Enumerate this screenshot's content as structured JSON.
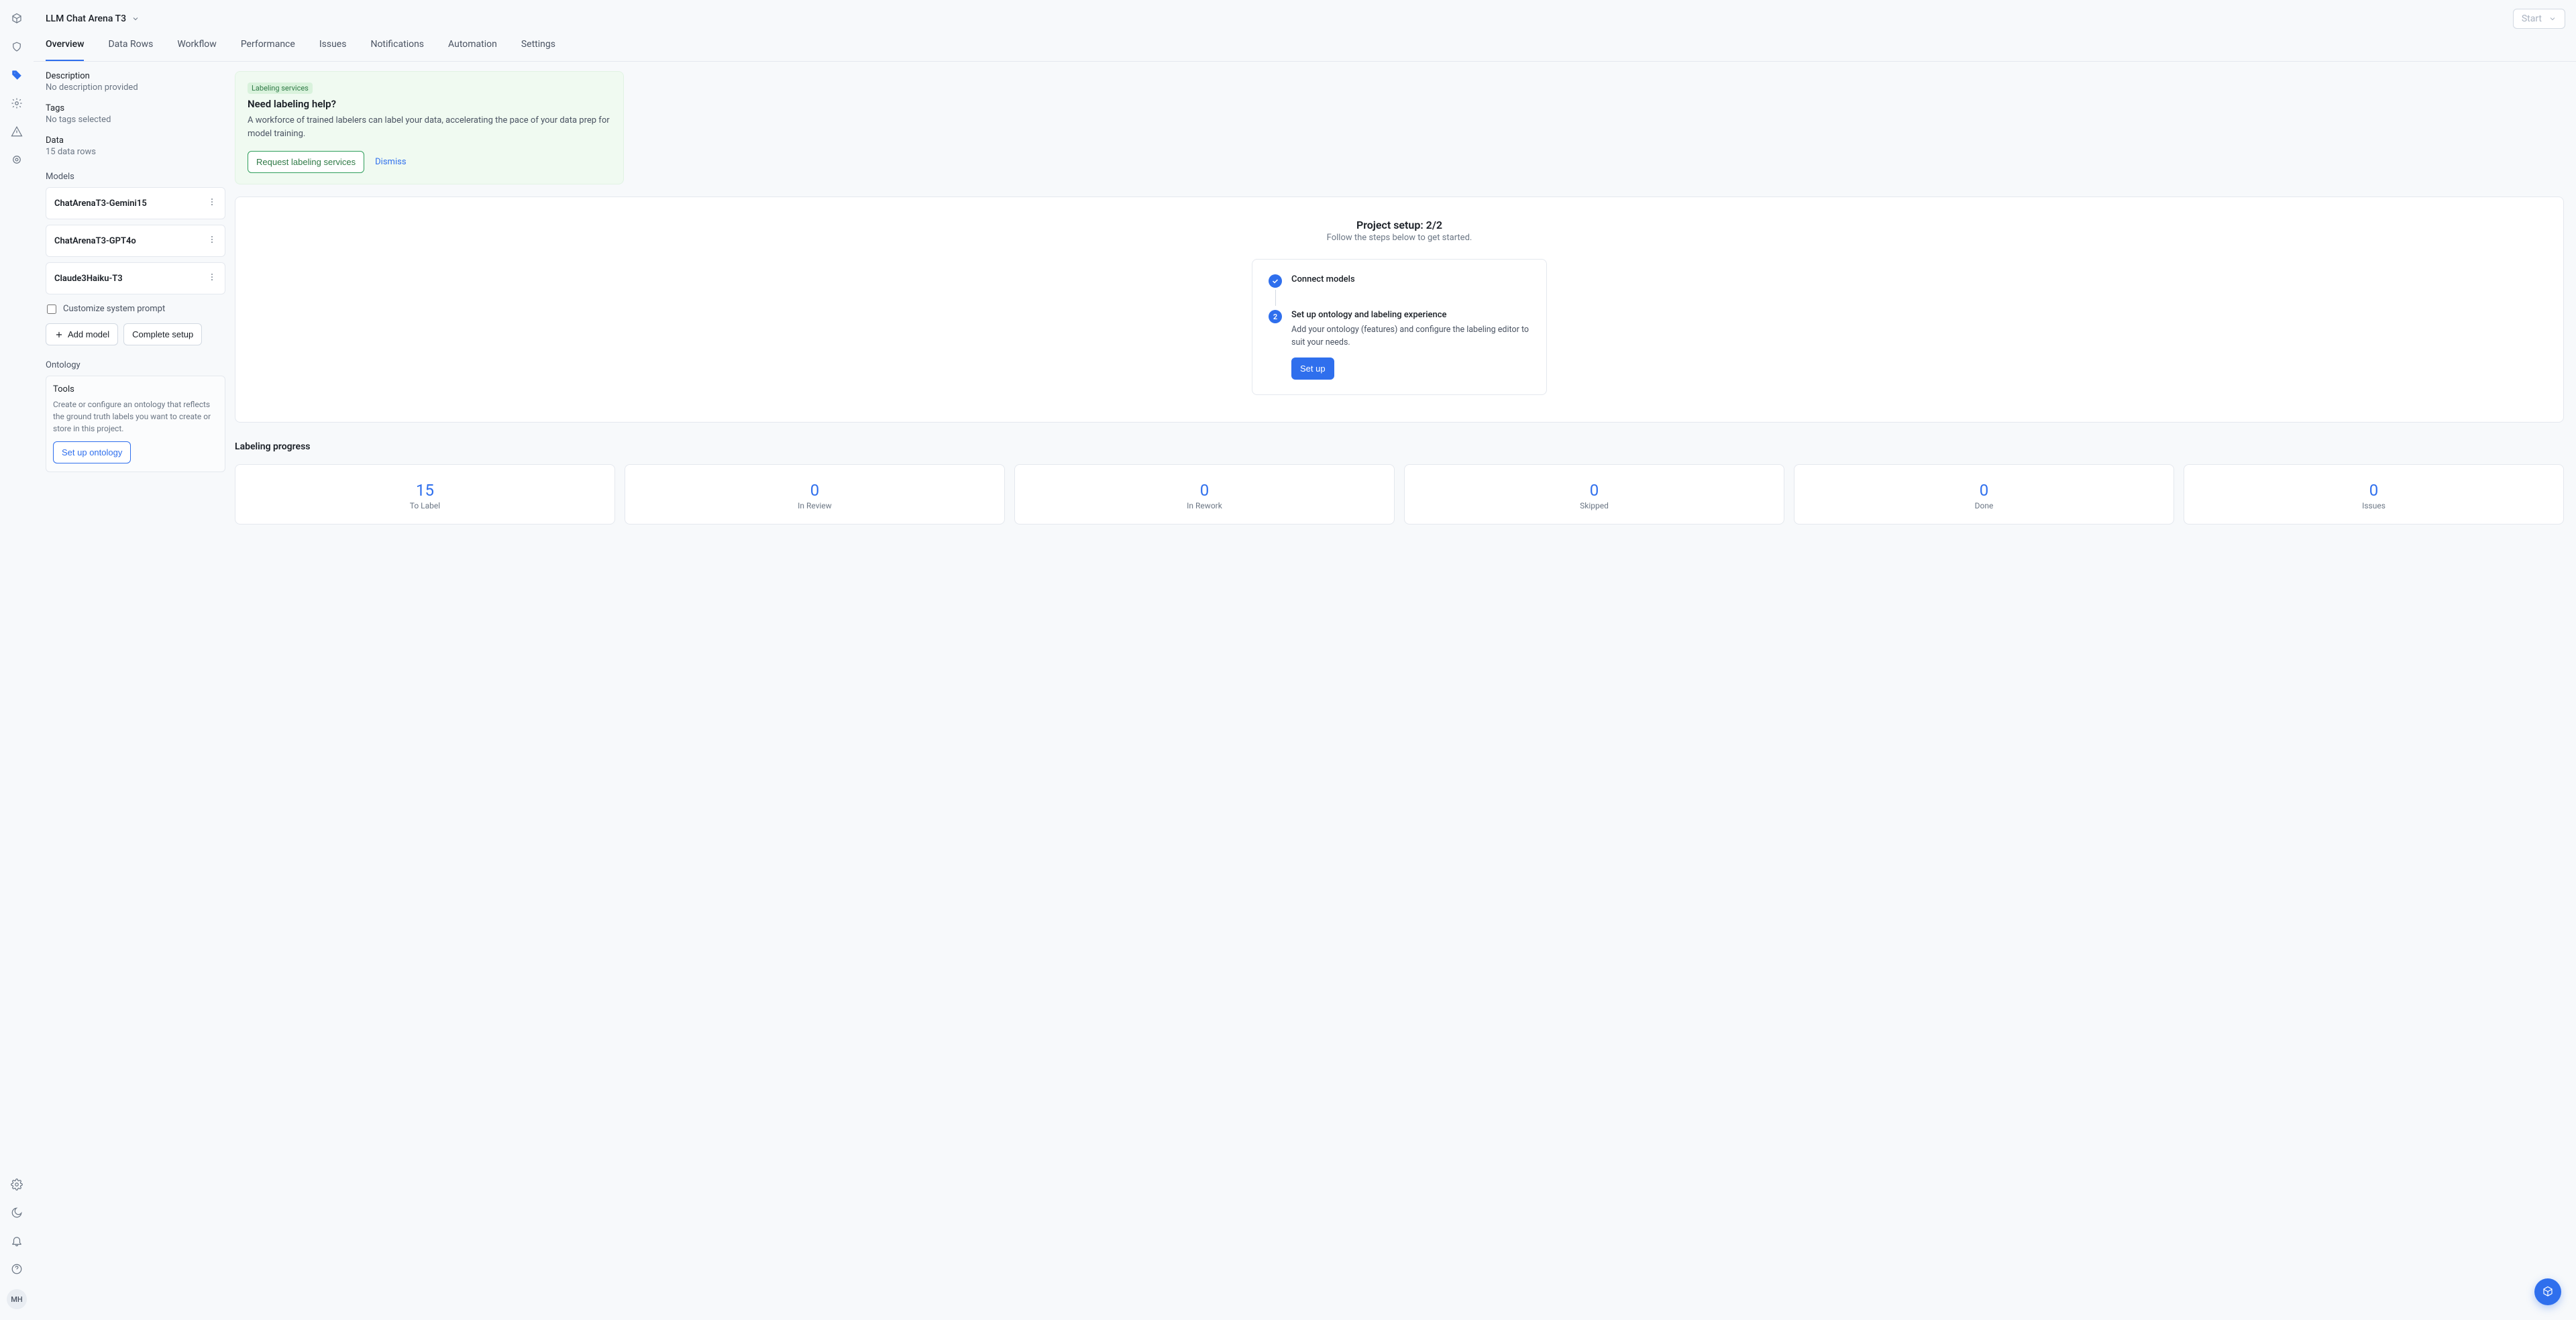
{
  "header": {
    "title": "LLM Chat Arena T3",
    "start_label": "Start"
  },
  "avatar_initials": "MH",
  "tabs": [
    {
      "label": "Overview",
      "active": true
    },
    {
      "label": "Data Rows"
    },
    {
      "label": "Workflow"
    },
    {
      "label": "Performance"
    },
    {
      "label": "Issues"
    },
    {
      "label": "Notifications"
    },
    {
      "label": "Automation"
    },
    {
      "label": "Settings"
    }
  ],
  "meta": {
    "description_label": "Description",
    "description_value": "No description provided",
    "tags_label": "Tags",
    "tags_value": "No tags selected",
    "data_label": "Data",
    "data_value": "15 data rows"
  },
  "models_label": "Models",
  "models": [
    {
      "name": "ChatArenaT3-Gemini15"
    },
    {
      "name": "ChatArenaT3-GPT4o"
    },
    {
      "name": "Claude3Haiku-T3"
    }
  ],
  "customize_prompt_label": "Customize system prompt",
  "add_model_label": "Add model",
  "complete_setup_label": "Complete setup",
  "ontology_label": "Ontology",
  "ontology_card": {
    "title": "Tools",
    "desc": "Create or configure an ontology that reflects the ground truth labels you want to create or store in this project.",
    "cta": "Set up ontology"
  },
  "banner": {
    "badge": "Labeling services",
    "title": "Need labeling help?",
    "body": "A workforce of trained labelers can label your data, accelerating the pace of your data prep for model training.",
    "request_btn": "Request labeling services",
    "dismiss": "Dismiss"
  },
  "setup": {
    "title": "Project setup: 2/2",
    "subtitle": "Follow the steps below to get started.",
    "step1_label": "Connect models",
    "step2_num": "2",
    "step2_label": "Set up ontology and labeling experience",
    "step2_desc": "Add your ontology (features) and configure the labeling editor to suit your needs.",
    "step2_cta": "Set up"
  },
  "progress_title": "Labeling progress",
  "stats": [
    {
      "num": "15",
      "label": "To Label"
    },
    {
      "num": "0",
      "label": "In Review"
    },
    {
      "num": "0",
      "label": "In Rework"
    },
    {
      "num": "0",
      "label": "Skipped"
    },
    {
      "num": "0",
      "label": "Done"
    },
    {
      "num": "0",
      "label": "Issues"
    }
  ]
}
